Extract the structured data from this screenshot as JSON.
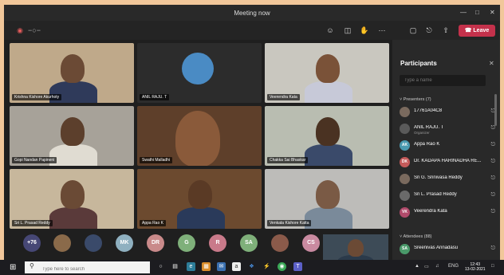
{
  "window": {
    "title": "Meeting now"
  },
  "toolbar": {
    "leave_label": "Leave"
  },
  "tiles": [
    {
      "name": "Krishna Kishore Akurhoty",
      "bg": "#bfa98a"
    },
    {
      "name": "ANIL RAJU. T",
      "bg": "#2c2c2c"
    },
    {
      "name": "Veerendra Kata",
      "bg": "#c9c7bf"
    },
    {
      "name": "Gopi Nandan Papineni",
      "bg": "#a7a299"
    },
    {
      "name": "Swathi Malladhi",
      "bg": "#5e3f2a"
    },
    {
      "name": "Chakka Sai Bhaskar",
      "bg": "#b9bdb1"
    },
    {
      "name": "Sri L. Prasad Reddy",
      "bg": "#c7b79c"
    },
    {
      "name": "Appa Rao K",
      "bg": "#6c4a2f"
    },
    {
      "name": "Venkata Kishore Katta",
      "bg": "#bdbcb9"
    }
  ],
  "participants": {
    "title": "Participants",
    "search_placeholder": "Type a name",
    "presenters_header": "Presenters (7)",
    "attendees_header": "Attendees (88)",
    "organizer_role": "Organizer",
    "presenters": [
      {
        "name": "17761A04C8",
        "initials": "",
        "color": "#7a6a5e"
      },
      {
        "name": "ANIL RAJU. T",
        "initials": "",
        "color": "#5a5a5a"
      },
      {
        "name": "Appa Rao K",
        "initials": "AK",
        "color": "#4a9ab0"
      },
      {
        "name": "Dr. KADAPA HARINADHA RE...",
        "initials": "DK",
        "color": "#c45a5a"
      },
      {
        "name": "Sri G. Srinivasa Reddy",
        "initials": "",
        "color": "#7a6a5e"
      },
      {
        "name": "Sri L. Prasad Reddy",
        "initials": "",
        "color": "#6a6a6a"
      },
      {
        "name": "Veerendra Kata",
        "initials": "VK",
        "color": "#b04a6a"
      }
    ],
    "attendees": [
      {
        "name": "Sreenivas Annadasu",
        "initials": "SA",
        "color": "#4a9a6a"
      }
    ]
  },
  "strip": {
    "overflow_label": "+76",
    "chips": [
      {
        "initials": "",
        "color": "#8a6a4a"
      },
      {
        "initials": "",
        "color": "#3a4a6a"
      },
      {
        "initials": "MK",
        "color": "#8fb0c0"
      },
      {
        "initials": "DR",
        "color": "#c98a8a"
      },
      {
        "initials": "G",
        "color": "#7fb07a"
      },
      {
        "initials": "R",
        "color": "#c97a8a"
      },
      {
        "initials": "SA",
        "color": "#7fb07a"
      },
      {
        "initials": "",
        "color": "#8a5a4a"
      },
      {
        "initials": "CS",
        "color": "#c98aa0"
      }
    ]
  },
  "taskbar": {
    "search_placeholder": "Type here to search",
    "lang": "ENG",
    "time": "12:43",
    "date": "13-02-2021"
  }
}
